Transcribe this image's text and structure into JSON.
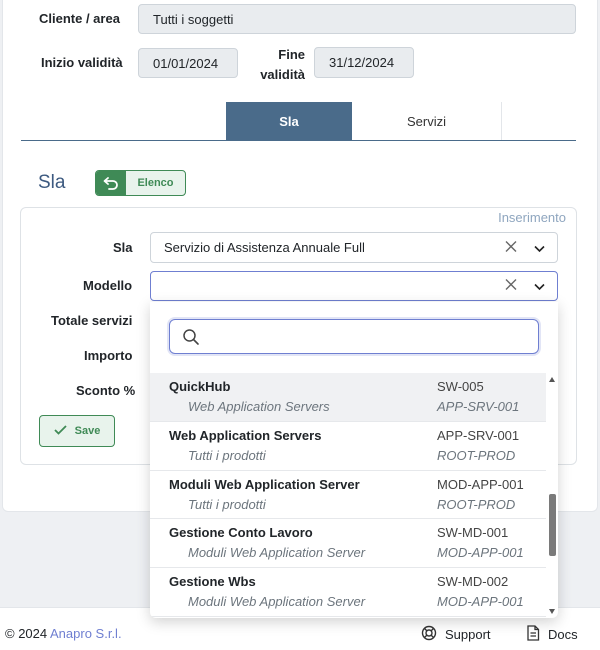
{
  "header": {
    "cliente_label": "Cliente / area",
    "cliente_value": "Tutti i soggetti",
    "inizio_label": "Inizio validità",
    "inizio_value": "01/01/2024",
    "fine_label_1": "Fine",
    "fine_label_2": "validità",
    "fine_value": "31/12/2024"
  },
  "tabs": [
    {
      "label": "Sla",
      "active": true
    },
    {
      "label": "Servizi",
      "active": false
    }
  ],
  "section": {
    "title": "Sla",
    "back_button_label": "Elenco"
  },
  "form": {
    "mode_label": "Inserimento",
    "sla_label": "Sla",
    "sla_value": "Servizio di Assistenza Annuale Full",
    "modello_label": "Modello",
    "modello_value": "",
    "totale_label": "Totale servizi",
    "importo_label": "Importo",
    "sconto_label": "Sconto %",
    "save_label": "Save"
  },
  "dropdown": {
    "search_placeholder": "",
    "options": [
      {
        "name": "QuickHub",
        "code": "SW-005",
        "parent": "Web Application Servers",
        "parent_code": "APP-SRV-001"
      },
      {
        "name": "Web Application Servers",
        "code": "APP-SRV-001",
        "parent": "Tutti i prodotti",
        "parent_code": "ROOT-PROD"
      },
      {
        "name": "Moduli Web Application Server",
        "code": "MOD-APP-001",
        "parent": "Tutti i prodotti",
        "parent_code": "ROOT-PROD"
      },
      {
        "name": "Gestione Conto Lavoro",
        "code": "SW-MD-001",
        "parent": "Moduli Web Application Server",
        "parent_code": "MOD-APP-001"
      },
      {
        "name": "Gestione Wbs",
        "code": "SW-MD-002",
        "parent": "Moduli Web Application Server",
        "parent_code": "MOD-APP-001"
      }
    ]
  },
  "footer": {
    "copyright": "© 2024 ",
    "company": "Anapro S.r.l.",
    "support": "Support",
    "docs": "Docs"
  },
  "colors": {
    "accent": "#4a6b8a",
    "green": "#3f8a56",
    "focus": "#6f7fd1"
  }
}
